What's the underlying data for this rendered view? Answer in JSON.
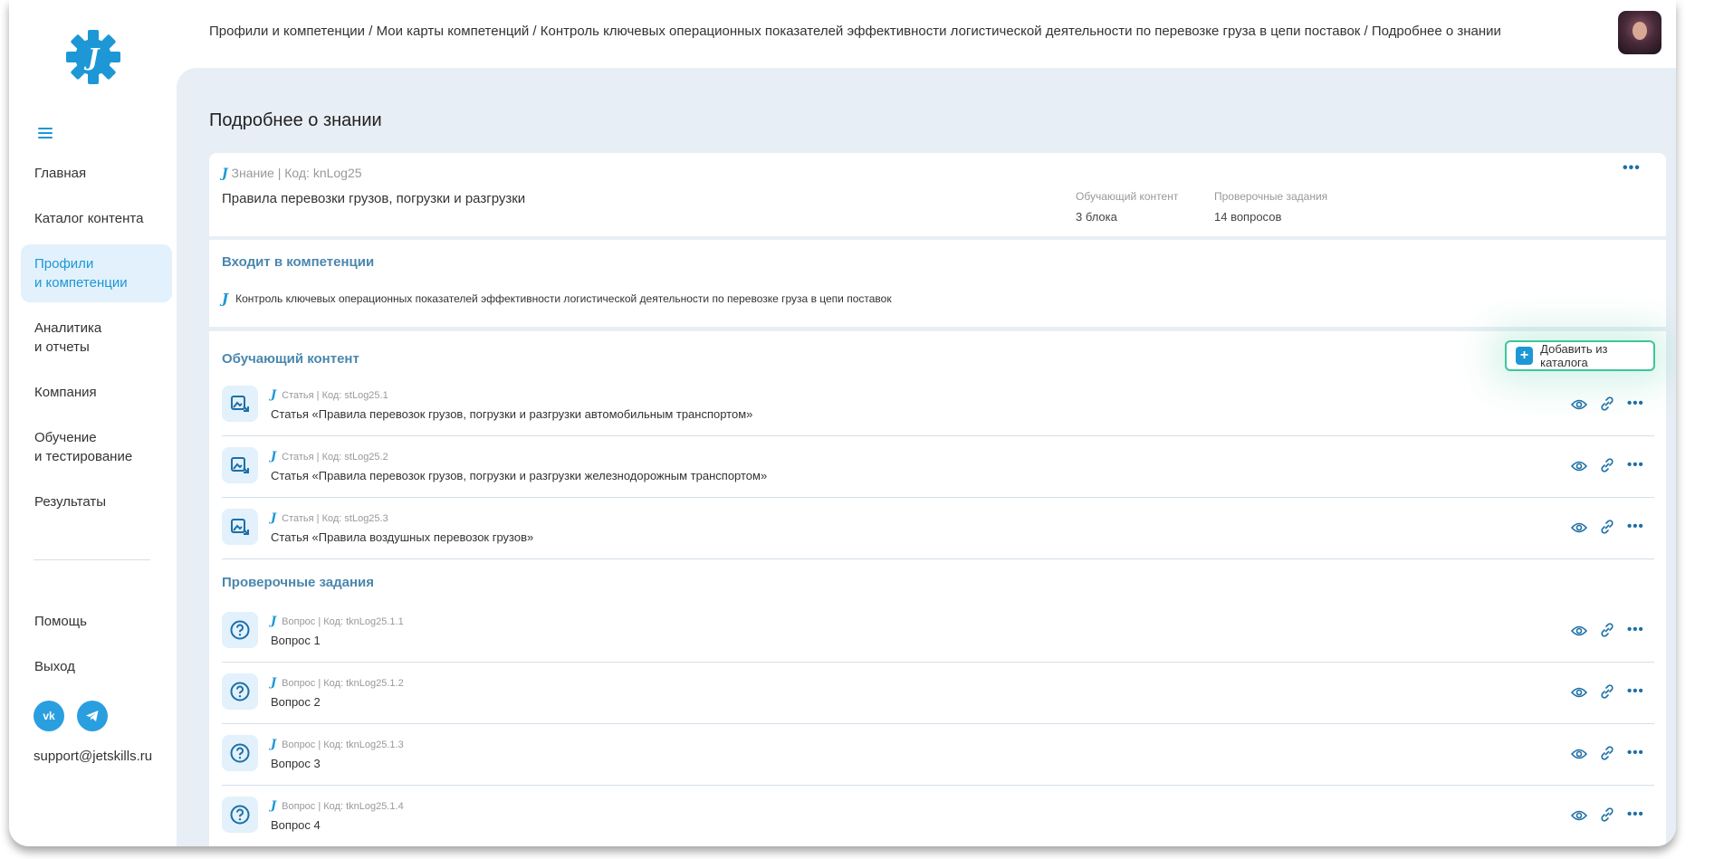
{
  "sidebar": {
    "nav": [
      {
        "label": "Главная",
        "active": false
      },
      {
        "label": "Каталог контента",
        "active": false
      },
      {
        "label": "Профили\nи компетенции",
        "active": true
      },
      {
        "label": "Аналитика\nи отчеты",
        "active": false
      },
      {
        "label": "Компания",
        "active": false
      },
      {
        "label": "Обучение\nи тестирование",
        "active": false
      },
      {
        "label": "Результаты",
        "active": false
      }
    ],
    "bottom": [
      {
        "label": "Помощь"
      },
      {
        "label": "Выход"
      }
    ],
    "social": [
      {
        "label": "vk"
      },
      {
        "icon": "telegram-icon"
      }
    ],
    "support_email": "support@jetskills.ru"
  },
  "breadcrumb": [
    "Профили и компетенции",
    "Мои карты компетенций",
    "Контроль ключевых операционных показателей эффективности логистической деятельности по перевозке груза в цепи поставок",
    "Подробнее о знании"
  ],
  "breadcrumb_separator": " / ",
  "page_title": "Подробнее о знании",
  "knowledge": {
    "j": "J",
    "meta": "Знание | Код: knLog25",
    "title": "Правила перевозки грузов, погрузки и разгрузки",
    "stats": [
      {
        "label": "Обучающий контент",
        "value": "3 блока"
      },
      {
        "label": "Проверочные задания",
        "value": "14 вопросов"
      }
    ]
  },
  "competencies": {
    "heading": "Входит в компетенции",
    "item": "Контроль ключевых операционных показателей эффективности логистической деятельности по перевозке груза в цепи поставок"
  },
  "learning": {
    "heading": "Обучающий контент",
    "add_button": "Добавить из каталога",
    "items": [
      {
        "meta": "Статья | Код: stLog25.1",
        "title": "Статья «Правила перевозок грузов, погрузки и разгрузки автомобильным транспортом»"
      },
      {
        "meta": "Статья | Код: stLog25.2",
        "title": "Статья «Правила перевозок грузов, погрузки и разгрузки железнодорожным транспортом»"
      },
      {
        "meta": "Статья | Код: stLog25.3",
        "title": "Статья «Правила воздушных перевозок грузов»"
      }
    ]
  },
  "tests": {
    "heading": "Проверочные задания",
    "items": [
      {
        "meta": "Вопрос | Код: tknLog25.1.1",
        "title": "Вопрос 1"
      },
      {
        "meta": "Вопрос | Код: tknLog25.1.2",
        "title": "Вопрос 2"
      },
      {
        "meta": "Вопрос | Код: tknLog25.1.3",
        "title": "Вопрос 3"
      },
      {
        "meta": "Вопрос | Код: tknLog25.1.4",
        "title": "Вопрос 4"
      }
    ]
  },
  "colors": {
    "accent": "#1d97d6",
    "highlight": "#3dc59b",
    "background": "#e8eef5"
  }
}
